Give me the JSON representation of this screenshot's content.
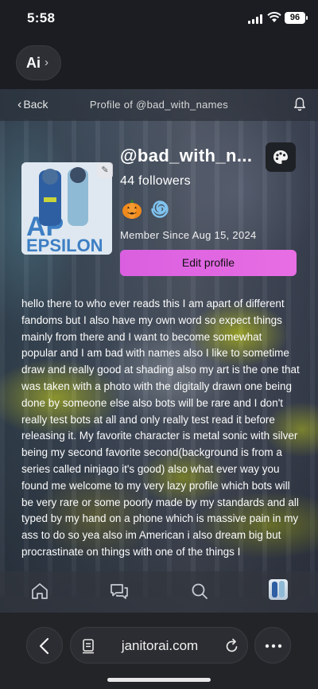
{
  "status_bar": {
    "time": "5:58",
    "battery": "96"
  },
  "top": {
    "ai_label": "Ai",
    "ai_chevron": "›"
  },
  "header": {
    "back_label": "Back",
    "title": "Profile of @bad_with_names"
  },
  "profile": {
    "username": "@bad_with_n...",
    "followers": "44 followers",
    "badges": [
      "pumpkin-icon",
      "spiral-icon"
    ],
    "member_since": "Member Since Aug 15, 2024",
    "edit_button": "Edit profile",
    "bio": "hello there to who ever reads this I am apart of different fandoms but I also have my own word so expect things mainly from there and I want to become somewhat popular and I am bad with names also I like to sometime draw and really good at shading also my art is the one that was taken with a photo with the digitally drawn one being done by someone else also bots will be rare and I don't really test bots at all and only really test read it before releasing it. My favorite character is metal sonic with silver being my second favorite second(background is from a series called ninjago it's good) also what ever way you found me welcome to my very lazy profile which bots will be very rare or some poorly made by my standards and all typed by my hand on a phone which is massive pain in my ass to do so yea also im American i also dream big but procrastinate on things with one of the things I"
  },
  "bottom_nav": {
    "items": [
      "home-icon",
      "chat-icon",
      "search-icon",
      "profile-avatar"
    ]
  },
  "browser": {
    "url": "janitorai.com"
  },
  "colors": {
    "accent": "#e06ae2",
    "background": "#1b1d22"
  }
}
